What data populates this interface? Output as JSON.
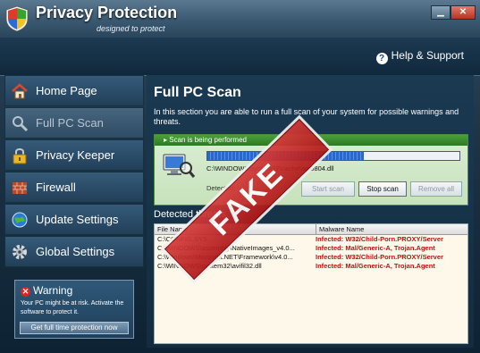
{
  "app": {
    "title": "Privacy Protection",
    "subtitle": "designed to protect",
    "help_label": "Help & Support"
  },
  "sidebar": {
    "items": [
      {
        "label": "Home Page",
        "icon": "home-icon"
      },
      {
        "label": "Full PC Scan",
        "icon": "magnifier-icon",
        "active": true
      },
      {
        "label": "Privacy Keeper",
        "icon": "lock-icon"
      },
      {
        "label": "Firewall",
        "icon": "brick-wall-icon"
      },
      {
        "label": "Update Settings",
        "icon": "globe-icon"
      },
      {
        "label": "Global Settings",
        "icon": "gear-icon"
      }
    ],
    "warning": {
      "title": "Warning",
      "text": "Your PC might be at risk. Activate the software to protect it.",
      "button": "Get full time protection now"
    }
  },
  "main": {
    "title": "Full PC Scan",
    "description": "In this section you are able to run a full scan of your system for possible warnings and threats.",
    "scan": {
      "status": "Scan is being performed",
      "current_file": "C:\\WINDOWS\\system32\\cache\\agt0804.dll",
      "detected": "Detected:",
      "progress": 0.62,
      "buttons": {
        "start": "Start scan",
        "stop": "Stop scan",
        "remove": "Remove all"
      }
    },
    "threats": {
      "label": "Detected threats",
      "columns": [
        "File Name",
        "Malware Name"
      ],
      "rows": [
        {
          "file": "C:\\CONFIG.SYS",
          "malware": "Infected: W32/Child-Porn.PROXY/Server"
        },
        {
          "file": "C:\\WINDOWS\\assembly\\NativeImages_v4.0...",
          "malware": "Infected: Mal/Generic-A, Trojan.Agent"
        },
        {
          "file": "C:\\Windows\\Microsoft.NET\\Framework\\v4.0...",
          "malware": "Infected: W32/Child-Porn.PROXY/Server"
        },
        {
          "file": "C:\\WINDOWS\\system32\\avifil32.dll",
          "malware": "Infected: Mal/Generic-A, Trojan.Agent"
        }
      ]
    }
  },
  "stamp": "FAKE",
  "colors": {
    "accent": "#2a67c8",
    "danger": "#c41010",
    "panel_green": "#4aa03a"
  }
}
